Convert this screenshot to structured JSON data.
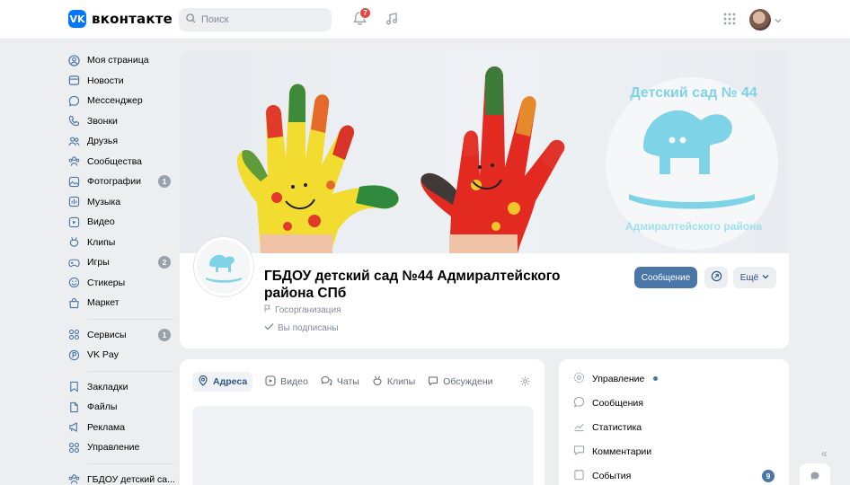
{
  "header": {
    "logo_mark": "VK",
    "logo_text": "вконтакте",
    "search_placeholder": "Поиск",
    "notifications_count": "7"
  },
  "sidebar": {
    "items": [
      {
        "label": "Моя страница",
        "icon": "user-circle-icon"
      },
      {
        "label": "Новости",
        "icon": "news-icon"
      },
      {
        "label": "Мессенджер",
        "icon": "message-icon"
      },
      {
        "label": "Звонки",
        "icon": "phone-icon"
      },
      {
        "label": "Друзья",
        "icon": "friends-icon"
      },
      {
        "label": "Сообщества",
        "icon": "communities-icon"
      },
      {
        "label": "Фотографии",
        "icon": "photo-icon",
        "badge": "1"
      },
      {
        "label": "Музыка",
        "icon": "music-icon"
      },
      {
        "label": "Видео",
        "icon": "video-icon"
      },
      {
        "label": "Клипы",
        "icon": "clips-icon"
      },
      {
        "label": "Игры",
        "icon": "gamepad-icon",
        "badge": "2"
      },
      {
        "label": "Стикеры",
        "icon": "sticker-icon"
      },
      {
        "label": "Маркет",
        "icon": "bag-icon"
      }
    ],
    "group2": [
      {
        "label": "Сервисы",
        "icon": "services-icon",
        "badge": "1"
      },
      {
        "label": "VK Pay",
        "icon": "vkpay-icon"
      }
    ],
    "group3": [
      {
        "label": "Закладки",
        "icon": "bookmark-icon"
      },
      {
        "label": "Файлы",
        "icon": "file-icon"
      },
      {
        "label": "Реклама",
        "icon": "ads-icon"
      },
      {
        "label": "Управление",
        "icon": "grid-icon"
      }
    ],
    "group4": [
      {
        "label": "ГБДОУ детский са...",
        "icon": "community-icon"
      }
    ]
  },
  "cover": {
    "title": "Детский сад № 44",
    "subtitle": "Адмиралтейского района"
  },
  "profile": {
    "name": "ГБДОУ детский сад №44 Адмиралтейского района СПб",
    "type": "Госорганизация",
    "subscribed": "Вы подписаны",
    "message_button": "Сообщение",
    "more_button": "Ещё"
  },
  "tabs": [
    {
      "label": "Адреса",
      "icon": "location-icon",
      "active": true
    },
    {
      "label": "Видео",
      "icon": "video-icon"
    },
    {
      "label": "Чаты",
      "icon": "chats-icon"
    },
    {
      "label": "Клипы",
      "icon": "clips-icon"
    },
    {
      "label": "Обсуждени",
      "icon": "discussion-icon"
    }
  ],
  "right_menu": [
    {
      "label": "Управление",
      "icon": "gear-icon",
      "dot": true
    },
    {
      "label": "Сообщения",
      "icon": "message-icon"
    },
    {
      "label": "Статистика",
      "icon": "stats-icon"
    },
    {
      "label": "Комментарии",
      "icon": "comment-icon"
    },
    {
      "label": "События",
      "icon": "events-icon",
      "badge": "9"
    }
  ],
  "colors": {
    "accent": "#4a76a8",
    "brand": "#0077ff",
    "horse": "#7fd3e6",
    "background": "#edeef0"
  }
}
